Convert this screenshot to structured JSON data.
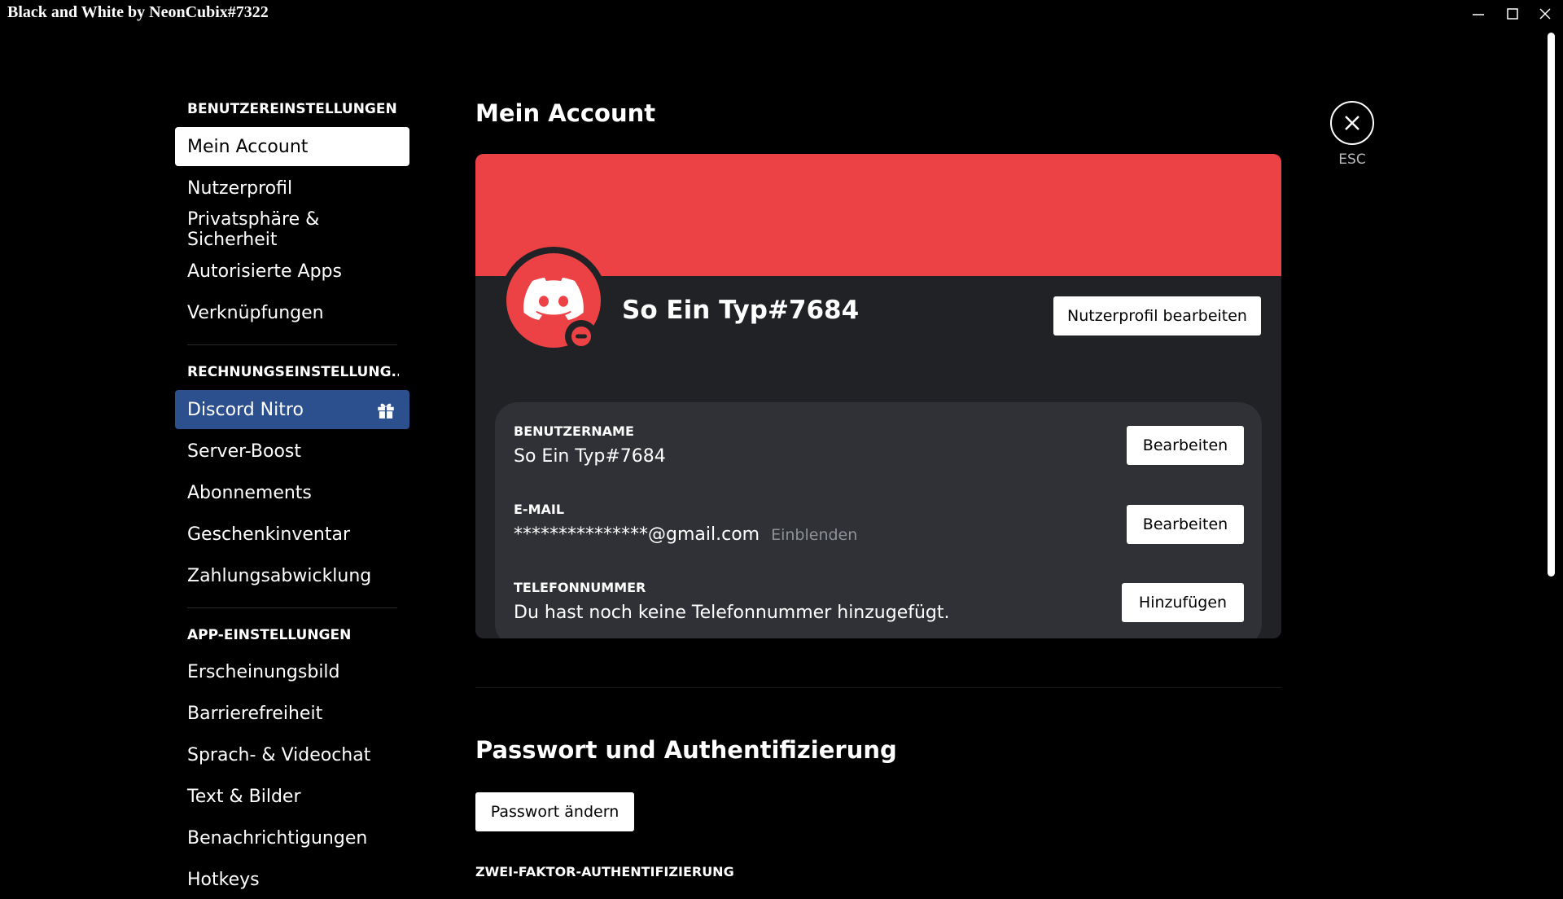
{
  "window": {
    "title": "Black and White by NeonCubix#7322"
  },
  "sidebar": {
    "sections": [
      {
        "header": "BENUTZEREINSTELLUNGEN",
        "items": [
          "Mein Account",
          "Nutzerprofil",
          "Privatsphäre & Sicherheit",
          "Autorisierte Apps",
          "Verknüpfungen"
        ]
      },
      {
        "header": "RECHNUNGSEINSTELLUNG...",
        "items": [
          "Discord Nitro",
          "Server-Boost",
          "Abonnements",
          "Geschenkinventar",
          "Zahlungsabwicklung"
        ]
      },
      {
        "header": "APP-EINSTELLUNGEN",
        "items": [
          "Erscheinungsbild",
          "Barrierefreiheit",
          "Sprach- & Videochat",
          "Text & Bilder",
          "Benachrichtigungen",
          "Hotkeys"
        ]
      }
    ],
    "selected_item": "Mein Account",
    "nitro_item": "Discord Nitro"
  },
  "main": {
    "title": "Mein Account",
    "profile": {
      "username": "So Ein Typ#7684",
      "edit_profile_button": "Nutzerprofil bearbeiten",
      "status": "do-not-disturb"
    },
    "fields": [
      {
        "label": "BENUTZERNAME",
        "value": "So Ein Typ#7684",
        "button": "Bearbeiten"
      },
      {
        "label": "E-MAIL",
        "value": "***************@gmail.com",
        "reveal": "Einblenden",
        "button": "Bearbeiten"
      },
      {
        "label": "TELEFONNUMMER",
        "value": "Du hast noch keine Telefonnummer hinzugefügt.",
        "button": "Hinzufügen"
      }
    ],
    "password_section": {
      "title": "Passwort und Authentifizierung",
      "change_password_button": "Passwort ändern",
      "two_factor_label": "ZWEI-FAKTOR-AUTHENTIFIZIERUNG"
    }
  },
  "close": {
    "label": "ESC"
  },
  "colors": {
    "banner": "#ed4245",
    "avatar": "#ed4245",
    "nitro": "#2c4f8e",
    "card": "#202225",
    "info_box": "#2f3136",
    "status_dnd": "#ed4245"
  },
  "icons": {
    "minimize": "minimize-icon",
    "maximize": "maximize-icon",
    "close_window": "close-window-icon",
    "gift": "gift-icon",
    "discord_logo": "discord-logo-icon",
    "close_settings": "close-icon"
  }
}
